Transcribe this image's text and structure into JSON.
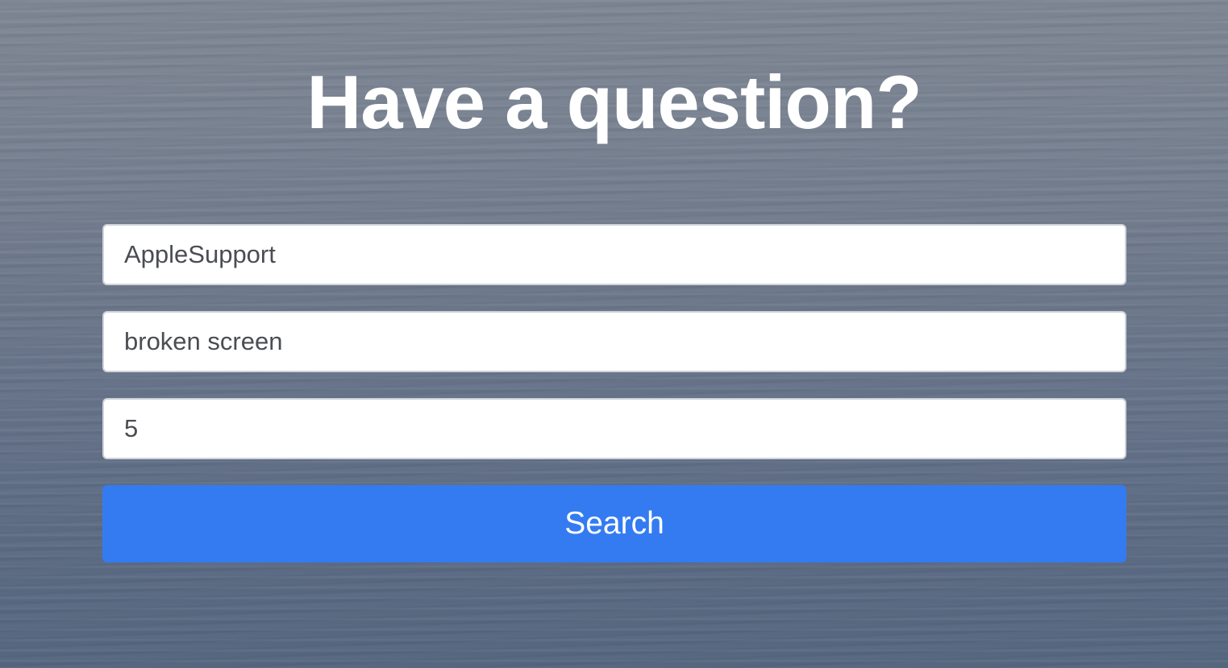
{
  "hero": {
    "title": "Have a question?"
  },
  "form": {
    "fields": [
      {
        "name": "account",
        "value": "AppleSupport"
      },
      {
        "name": "query",
        "value": "broken screen"
      },
      {
        "name": "count",
        "value": "5"
      }
    ],
    "submit_label": "Search"
  },
  "colors": {
    "button": "#347bf2",
    "title": "#ffffff",
    "field_background": "#ffffff",
    "field_text": "#4a4d52"
  }
}
